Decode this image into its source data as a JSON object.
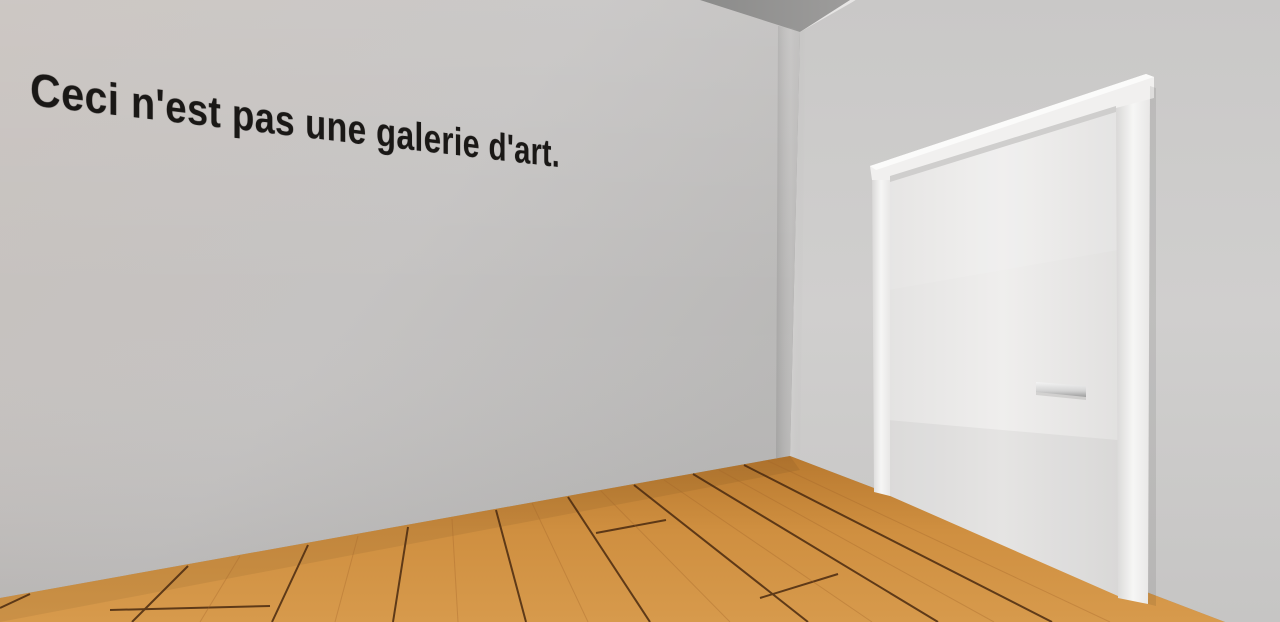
{
  "wall_inscription": {
    "text": "Ceci n'est pas une galerie d'art."
  },
  "scene": {
    "colors": {
      "left_wall": "#c9c6c3",
      "back_wall": "#d3d2d1",
      "ceiling": "#8e8d8c",
      "floor_wood": "#c98a3a",
      "plank_seam": "#4a2a10",
      "door": "#ecebea",
      "door_frame": "#f2f2f1",
      "door_handle": "#dcdcdc"
    },
    "objects": [
      "wall-inscription",
      "door",
      "door-handle",
      "wooden-floor",
      "ceiling"
    ]
  }
}
